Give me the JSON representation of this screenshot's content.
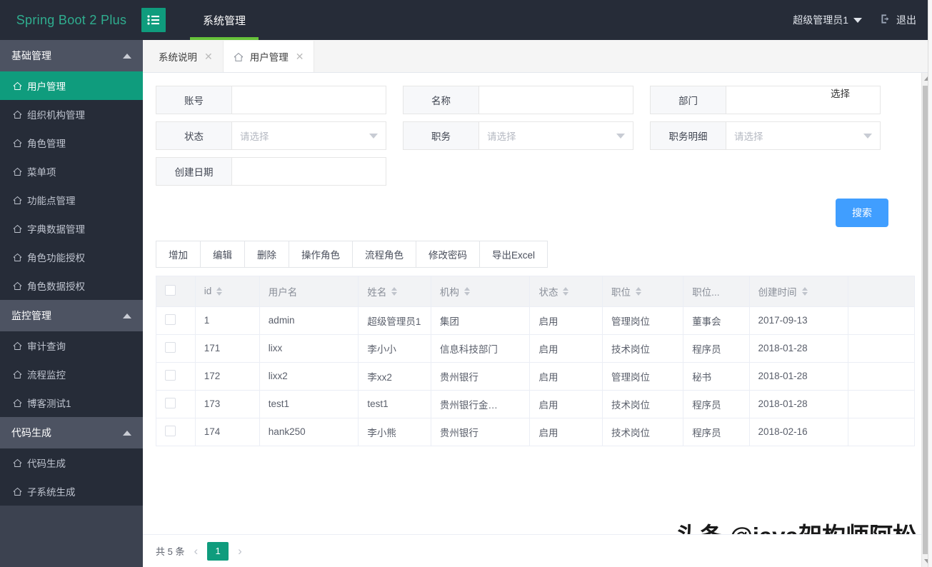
{
  "topbar": {
    "brand": "Spring Boot 2 Plus",
    "menu_toggle_icon": "list-menu-icon",
    "nav": [
      {
        "label": "系统管理",
        "active": true
      }
    ],
    "user_name": "超级管理员1",
    "user_caret_icon": "caret-down-icon",
    "logout_icon": "logout-icon",
    "logout_label": "退出",
    "accent_green": "#0f9c7d",
    "brand_color": "#2fae8f",
    "underline_color": "#67c23a",
    "background": "#262c38"
  },
  "sidebar": {
    "groups": [
      {
        "title": "基础管理",
        "collapse_icon": "caret-up-icon",
        "items": [
          {
            "label": "用户管理",
            "icon": "home-icon",
            "active": true
          },
          {
            "label": "组织机构管理",
            "icon": "home-icon",
            "active": false
          },
          {
            "label": "角色管理",
            "icon": "home-icon",
            "active": false
          },
          {
            "label": "菜单项",
            "icon": "home-icon",
            "active": false
          },
          {
            "label": "功能点管理",
            "icon": "home-icon",
            "active": false
          },
          {
            "label": "字典数据管理",
            "icon": "home-icon",
            "active": false
          },
          {
            "label": "角色功能授权",
            "icon": "home-icon",
            "active": false
          },
          {
            "label": "角色数据授权",
            "icon": "home-icon",
            "active": false
          }
        ]
      },
      {
        "title": "监控管理",
        "collapse_icon": "caret-up-icon",
        "items": [
          {
            "label": "审计查询",
            "icon": "home-icon",
            "active": false
          },
          {
            "label": "流程监控",
            "icon": "home-icon",
            "active": false
          },
          {
            "label": "博客测试1",
            "icon": "home-icon",
            "active": false
          }
        ]
      },
      {
        "title": "代码生成",
        "collapse_icon": "caret-up-icon",
        "items": [
          {
            "label": "代码生成",
            "icon": "home-icon",
            "active": false
          },
          {
            "label": "子系统生成",
            "icon": "home-icon",
            "active": false
          }
        ]
      }
    ]
  },
  "tabs": [
    {
      "label": "系统说明",
      "active": false,
      "has_home_icon": false,
      "close_icon": "close-icon"
    },
    {
      "label": "用户管理",
      "active": true,
      "has_home_icon": true,
      "close_icon": "close-icon"
    }
  ],
  "search_form": {
    "fields": [
      {
        "label": "账号",
        "type": "input",
        "value": "",
        "placeholder": ""
      },
      {
        "label": "名称",
        "type": "input",
        "value": "",
        "placeholder": ""
      },
      {
        "label": "部门",
        "type": "input",
        "value": "",
        "placeholder": ""
      },
      {
        "label": "状态",
        "type": "select",
        "value": "",
        "placeholder": "请选择"
      },
      {
        "label": "职务",
        "type": "select",
        "value": "",
        "placeholder": "请选择"
      },
      {
        "label": "职务明细",
        "type": "select",
        "value": "",
        "placeholder": "请选择"
      },
      {
        "label": "创建日期",
        "type": "input",
        "value": "",
        "placeholder": ""
      }
    ],
    "pick_link": "选择",
    "search_button": "搜索",
    "search_button_color": "#409eff"
  },
  "toolbar": {
    "buttons": [
      "增加",
      "编辑",
      "删除",
      "操作角色",
      "流程角色",
      "修改密码",
      "导出Excel"
    ]
  },
  "table": {
    "select_all_checkbox": "unchecked",
    "columns": [
      {
        "label": "",
        "sortable": false,
        "key": "checkbox"
      },
      {
        "label": "id",
        "sortable": true,
        "key": "id"
      },
      {
        "label": "用户名",
        "sortable": false,
        "key": "username"
      },
      {
        "label": "姓名",
        "sortable": true,
        "key": "name"
      },
      {
        "label": "机构",
        "sortable": true,
        "key": "org"
      },
      {
        "label": "状态",
        "sortable": true,
        "key": "status"
      },
      {
        "label": "职位",
        "sortable": true,
        "key": "post"
      },
      {
        "label": "职位...",
        "sortable": false,
        "key": "post_detail"
      },
      {
        "label": "创建时间",
        "sortable": true,
        "key": "created"
      },
      {
        "label": "",
        "sortable": false,
        "key": "spacer"
      }
    ],
    "rows": [
      {
        "checkbox": "",
        "id": "1",
        "username": "admin",
        "name": "超级管理员1",
        "org": "集团",
        "status": "启用",
        "post": "管理岗位",
        "post_detail": "董事会",
        "created": "2017-09-13",
        "spacer": ""
      },
      {
        "checkbox": "",
        "id": "171",
        "username": "lixx",
        "name": "李小小",
        "org": "信息科技部门",
        "status": "启用",
        "post": "技术岗位",
        "post_detail": "程序员",
        "created": "2018-01-28",
        "spacer": ""
      },
      {
        "checkbox": "",
        "id": "172",
        "username": "lixx2",
        "name": "李xx2",
        "org": "贵州银行",
        "status": "启用",
        "post": "管理岗位",
        "post_detail": "秘书",
        "created": "2018-01-28",
        "spacer": ""
      },
      {
        "checkbox": "",
        "id": "173",
        "username": "test1",
        "name": "test1",
        "org": "贵州银行金…",
        "status": "启用",
        "post": "技术岗位",
        "post_detail": "程序员",
        "created": "2018-01-28",
        "spacer": ""
      },
      {
        "checkbox": "",
        "id": "174",
        "username": "hank250",
        "name": "李小熊",
        "org": "贵州银行",
        "status": "启用",
        "post": "技术岗位",
        "post_detail": "程序员",
        "created": "2018-02-16",
        "spacer": ""
      }
    ]
  },
  "pagination": {
    "total_text": "共 5 条",
    "prev_icon": "chevron-left-icon",
    "next_icon": "chevron-right-icon",
    "current_page": "1",
    "active_color": "#0f9c7d"
  },
  "watermark": {
    "text": "头条 @java架构师阿松"
  }
}
